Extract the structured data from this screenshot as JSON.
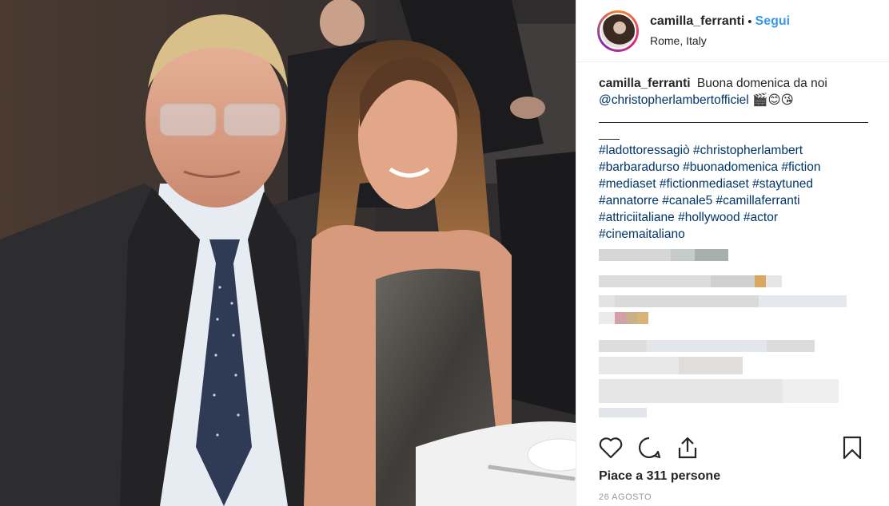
{
  "post": {
    "username": "camilla_ferranti",
    "follow_label": "Segui",
    "location": "Rome, Italy"
  },
  "caption": {
    "username": "camilla_ferranti",
    "text": "Buona domenica da noi",
    "mention": "@christopherlambertofficiel",
    "emojis": "🎬😊😘",
    "divider": "________________________________________________",
    "divider2": "___",
    "hashtags_line1": "#ladottoressagiò #christopherlambert",
    "hashtags_line2": "#barbaradurso #buonadomenica #fiction",
    "hashtags_line3": "#mediaset #fictionmediaset #staytuned",
    "hashtags_line4": "#annatorre #canale5 #camillaferranti",
    "hashtags_line5": "#attriciitaliane #hollywood #actor",
    "hashtags_line6": "#cinemaitaliano"
  },
  "engagement": {
    "likes_text": "Piace a 311 persone",
    "date": "26 AGOSTO"
  },
  "icons": [
    "heart-icon",
    "comment-icon",
    "share-icon",
    "bookmark-icon"
  ],
  "colors": {
    "follow": "#3897f0",
    "hashtag": "#003569",
    "text": "#262626",
    "muted": "#999999"
  }
}
